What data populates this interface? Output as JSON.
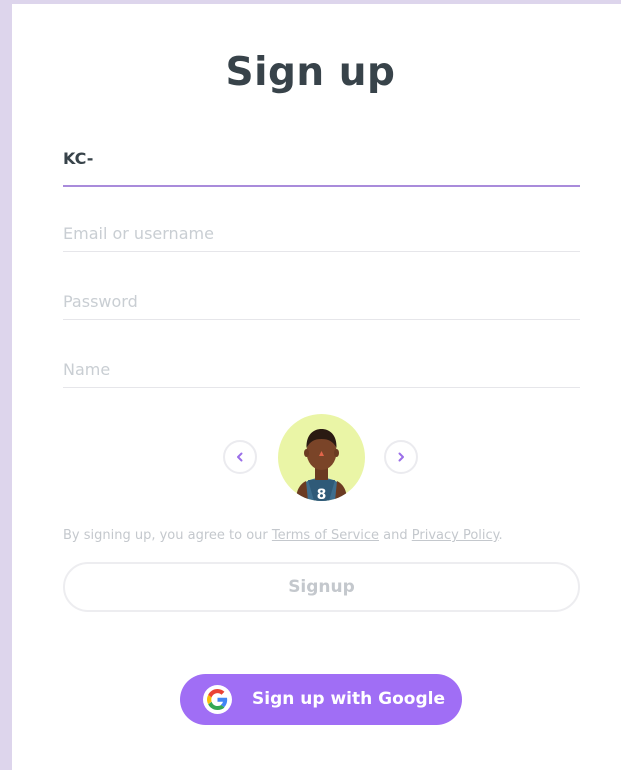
{
  "page": {
    "title": "Sign up"
  },
  "form": {
    "username_value": "KC-",
    "email_placeholder": "Email or username",
    "password_placeholder": "Password",
    "name_placeholder": "Name"
  },
  "avatar": {
    "jersey_number": "8",
    "prev_icon": "chevron-left-icon",
    "next_icon": "chevron-right-icon"
  },
  "terms": {
    "prefix": "By signing up, you agree to our ",
    "tos_link": "Terms of Service",
    "and": " and ",
    "privacy_link": "Privacy Policy",
    "suffix": "."
  },
  "buttons": {
    "signup_label": "Signup",
    "google_label": "Sign up with Google",
    "google_icon": "google-icon"
  },
  "colors": {
    "background": "#ddd5ec",
    "accent": "#a06ef5",
    "active_underline": "#a98bdb",
    "title": "#38434a",
    "avatar_bg": "#eaf5a6"
  }
}
